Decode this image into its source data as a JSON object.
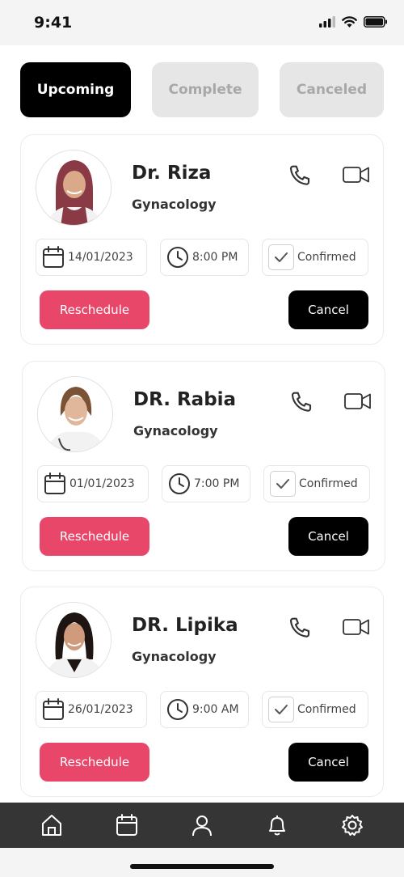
{
  "status_bar": {
    "time": "9:41"
  },
  "tabs": [
    {
      "label": "Upcoming",
      "active": true
    },
    {
      "label": "Complete",
      "active": false
    },
    {
      "label": "Canceled",
      "active": false
    }
  ],
  "appointments": [
    {
      "name": "Dr. Riza",
      "specialty": "Gynacology",
      "date": "14/01/2023",
      "time": "8:00 PM",
      "status": "Confirmed",
      "reschedule_label": "Reschedule",
      "cancel_label": "Cancel",
      "avatar_colors": {
        "headscarf": "#8a3a44",
        "coat": "#f2f2f2",
        "skin": "#d9a98a"
      }
    },
    {
      "name": "DR. Rabia",
      "specialty": "Gynacology",
      "date": "01/01/2023",
      "time": "7:00 PM",
      "status": "Confirmed",
      "reschedule_label": "Reschedule",
      "cancel_label": "Cancel",
      "avatar_colors": {
        "hair": "#7a5236",
        "coat": "#f2f2f2",
        "skin": "#e0b79a"
      }
    },
    {
      "name": "DR. Lipika",
      "specialty": "Gynacology",
      "date": "26/01/2023",
      "time": "9:00 AM",
      "status": "Confirmed",
      "reschedule_label": "Reschedule",
      "cancel_label": "Cancel",
      "avatar_colors": {
        "hair": "#1e1512",
        "coat": "#f2f2f2",
        "skin": "#cf9b7c"
      }
    }
  ],
  "bottom_nav": [
    {
      "icon": "home-icon"
    },
    {
      "icon": "calendar-icon"
    },
    {
      "icon": "profile-icon"
    },
    {
      "icon": "bell-icon"
    },
    {
      "icon": "settings-icon"
    }
  ],
  "colors": {
    "accent": "#e8476a",
    "primary": "#000000",
    "nav_background": "#353535"
  }
}
